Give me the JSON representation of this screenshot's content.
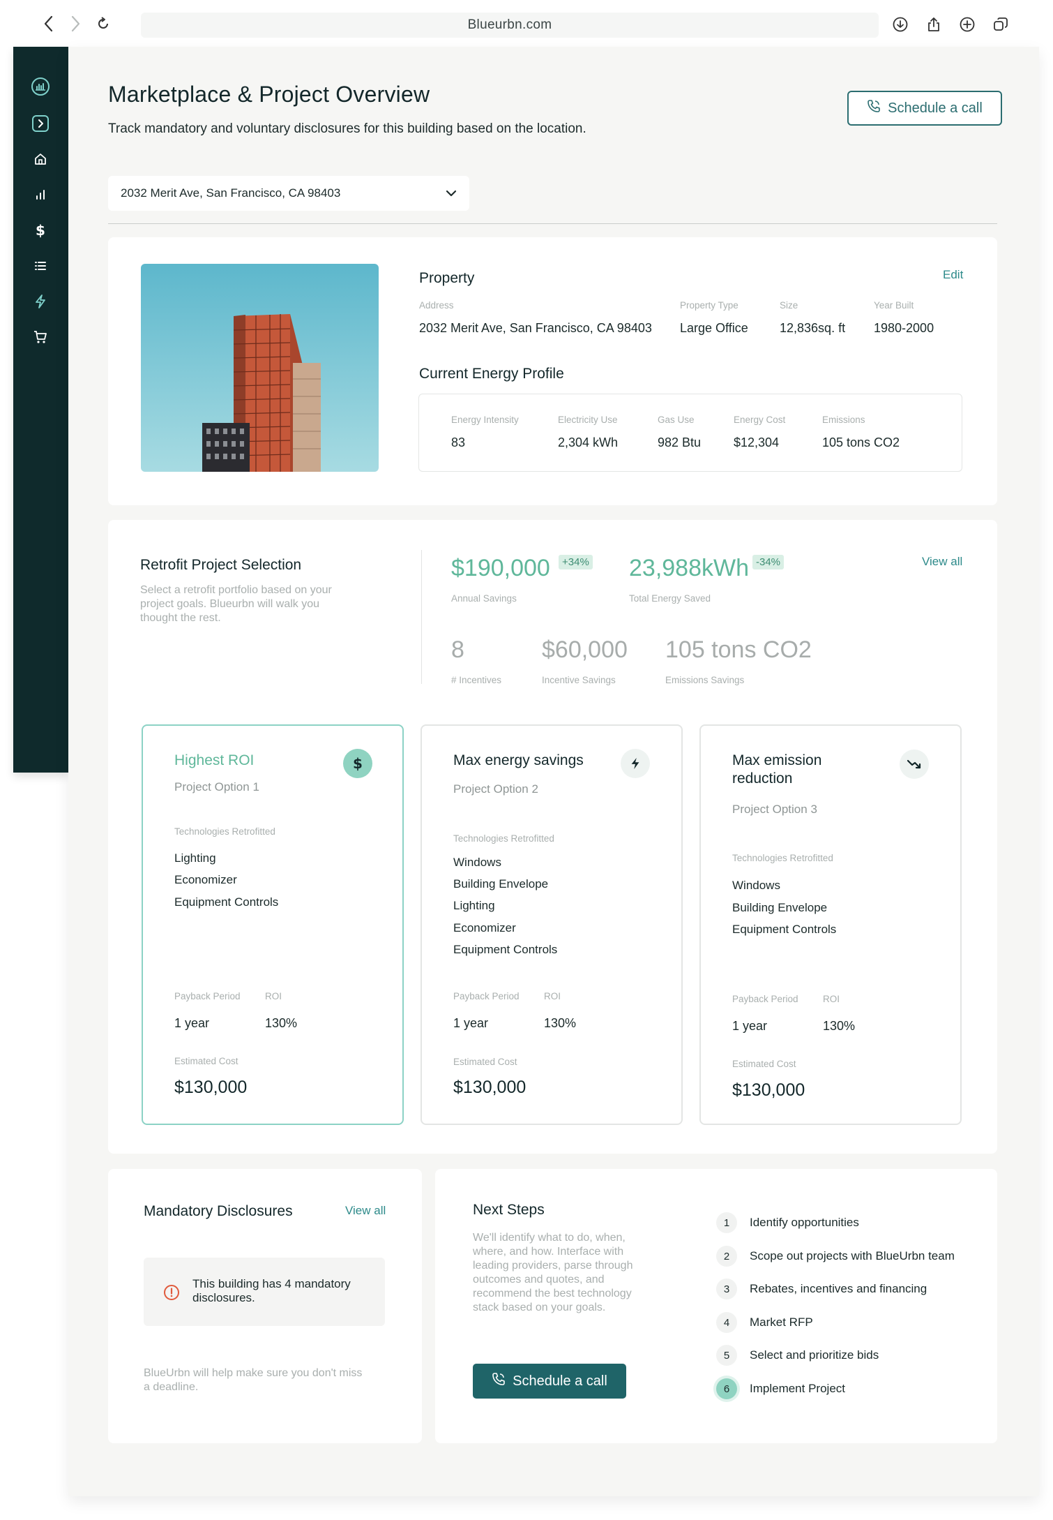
{
  "browser": {
    "url": "Blueurbn.com"
  },
  "header": {
    "title": "Marketplace & Project Overview",
    "subtitle": "Track mandatory and voluntary disclosures for this building based on the location.",
    "schedule_label": "Schedule a call"
  },
  "address_select": {
    "value": "2032 Merit Ave,  San Francisco, CA 98403"
  },
  "property": {
    "heading": "Property",
    "edit_label": "Edit",
    "fields": [
      {
        "label": "Address",
        "value": "2032 Merit Ave,  San Francisco, CA 98403"
      },
      {
        "label": "Property Type",
        "value": "Large Office"
      },
      {
        "label": "Size",
        "value": "12,836sq. ft"
      },
      {
        "label": "Year Built",
        "value": "1980-2000"
      }
    ]
  },
  "energy_profile": {
    "heading": "Current Energy Profile",
    "fields": [
      {
        "label": "Energy Intensity",
        "value": "83"
      },
      {
        "label": "Electricity Use",
        "value": "2,304 kWh"
      },
      {
        "label": "Gas Use",
        "value": "982 Btu"
      },
      {
        "label": "Energy Cost",
        "value": "$12,304"
      },
      {
        "label": "Emissions",
        "value": "105 tons CO2"
      }
    ]
  },
  "retrofit": {
    "heading": "Retrofit Project Selection",
    "description": "Select a retrofit portfolio based on your project goals. Blueurbn will walk you thought the rest.",
    "view_all": "View all",
    "stats": {
      "annual_savings": {
        "value": "$190,000",
        "badge": "+34%",
        "label": "Annual Savings"
      },
      "energy_saved": {
        "value": "23,988kWh",
        "badge": "-34%",
        "label": "Total Energy Saved"
      },
      "incentives": {
        "value": "8",
        "label": "# Incentives"
      },
      "incentive_savings": {
        "value": "$60,000",
        "label": "Incentive Savings"
      },
      "emissions_savings": {
        "value": "105 tons CO2",
        "label": "Emissions Savings"
      }
    }
  },
  "options": [
    {
      "title": "Highest ROI",
      "subtitle": "Project Option 1",
      "icon": "dollar-icon",
      "tech_label": "Technologies Retrofitted",
      "tech": [
        "Lighting",
        "Economizer",
        "Equipment Controls"
      ],
      "payback_label": "Payback Period",
      "payback": "1 year",
      "roi_label": "ROI",
      "roi": "130%",
      "cost_label": "Estimated Cost",
      "cost": "$130,000"
    },
    {
      "title": "Max energy savings",
      "subtitle": "Project Option 2",
      "icon": "bolt-icon",
      "tech_label": "Technologies Retrofitted",
      "tech": [
        "Windows",
        "Building Envelope",
        "Lighting",
        "Economizer",
        "Equipment Controls"
      ],
      "payback_label": "Payback Period",
      "payback": "1 year",
      "roi_label": "ROI",
      "roi": "130%",
      "cost_label": "Estimated Cost",
      "cost": "$130,000"
    },
    {
      "title_line1": "Max emission",
      "title_line2": "reduction",
      "subtitle": "Project Option 3",
      "icon": "trend-down-icon",
      "tech_label": "Technologies Retrofitted",
      "tech": [
        "Windows",
        "Building Envelope",
        "Equipment Controls"
      ],
      "payback_label": "Payback Period",
      "payback": "1 year",
      "roi_label": "ROI",
      "roi": "130%",
      "cost_label": "Estimated Cost",
      "cost": "$130,000"
    }
  ],
  "disclosures": {
    "heading": "Mandatory Disclosures",
    "view_all": "View all",
    "alert_line1": "This building has 4 mandatory",
    "alert_line2": "disclosures.",
    "footer": "BlueUrbn will help make sure you don't miss a deadline."
  },
  "next_steps": {
    "heading": "Next Steps",
    "description": "We'll identify what to do, when, where, and how. Interface with leading providers, parse through outcomes and quotes, and recommend the best technology stack based on your goals.",
    "button_label": "Schedule a call",
    "active_step": 6,
    "steps": [
      {
        "num": "1",
        "label": "Identify opportunities"
      },
      {
        "num": "2",
        "label": "Scope out projects with BlueUrbn team"
      },
      {
        "num": "3",
        "label": "Rebates, incentives and financing"
      },
      {
        "num": "4",
        "label": "Market RFP"
      },
      {
        "num": "5",
        "label": "Select and prioritize bids"
      },
      {
        "num": "6",
        "label": "Implement Project"
      }
    ]
  },
  "colors": {
    "sidebar_bg": "#0f2a2c",
    "accent": "#2b6d70",
    "green": "#5fb79a",
    "alert_red": "#e05a3c"
  }
}
